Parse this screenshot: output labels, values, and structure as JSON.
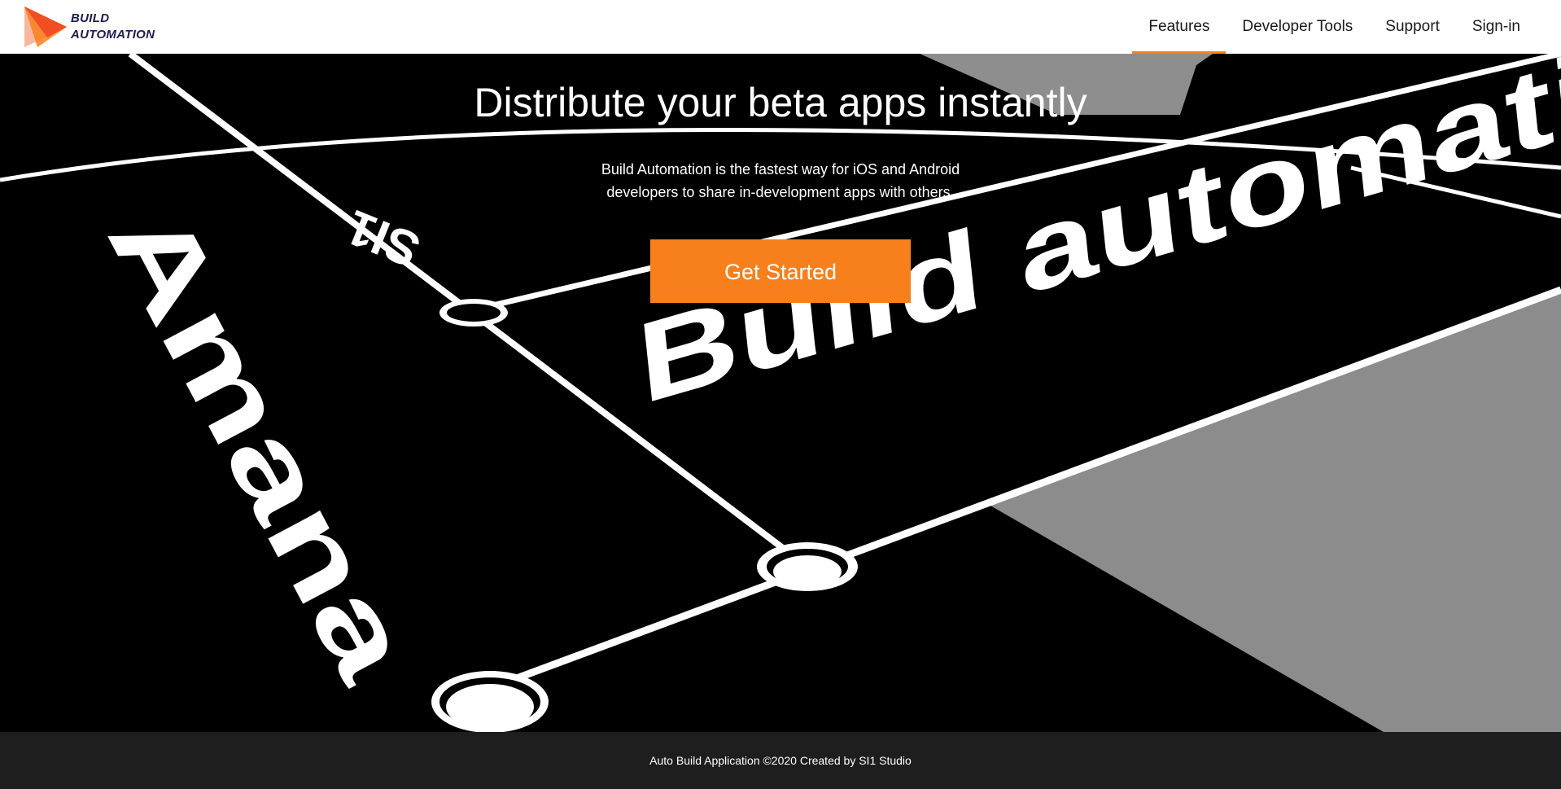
{
  "brand": {
    "line1": "BUILD",
    "line2": "AUTOMATION",
    "icon": "play-arrow-logo-icon",
    "colors": [
      "#f04e23",
      "#f7801d",
      "#f9b7a0"
    ]
  },
  "nav": {
    "items": [
      {
        "label": "Features",
        "active": true
      },
      {
        "label": "Developer Tools",
        "active": false
      },
      {
        "label": "Support",
        "active": false
      },
      {
        "label": "Sign-in",
        "active": false
      }
    ],
    "active_color": "#f7801d"
  },
  "hero": {
    "title": "Distribute your beta apps instantly",
    "subtitle": "Build Automation is the fastest way for iOS and Android developers to share in-development apps with others.",
    "cta_label": "Get Started",
    "cta_color": "#f7801d",
    "background_text": {
      "word1": "Amana",
      "word2": "Build automation",
      "word3": "SI1"
    }
  },
  "footer": {
    "text": "Auto Build Application ©2020 Created by SI1 Studio",
    "background": "#1e1e1e"
  }
}
